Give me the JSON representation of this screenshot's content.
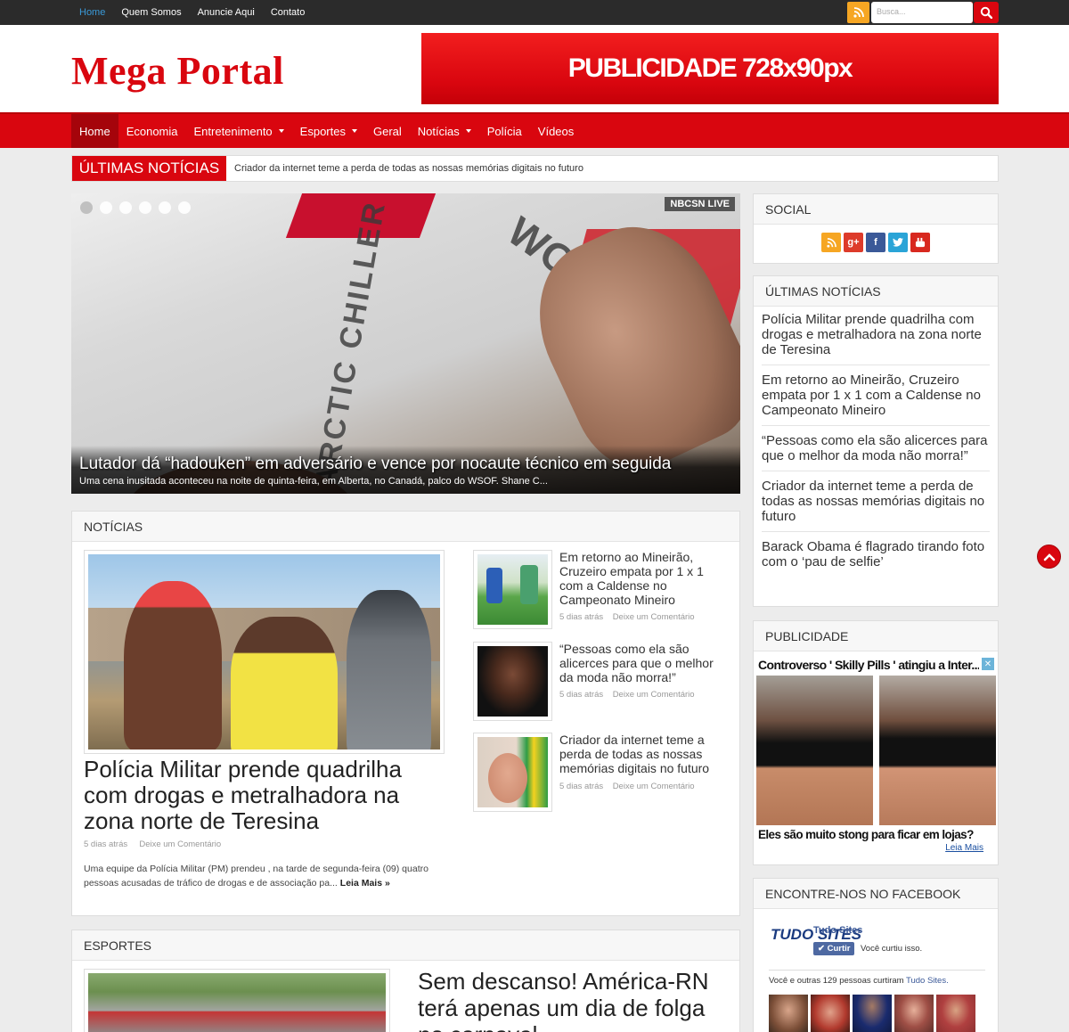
{
  "topbar": {
    "links": [
      "Home",
      "Quem Somos",
      "Anuncie Aqui",
      "Contato"
    ],
    "search_placeholder": "Busca..."
  },
  "header": {
    "logo": "Mega Portal",
    "ad_text": "PUBLICIDADE 728x90px"
  },
  "nav": {
    "items": [
      {
        "label": "Home",
        "active": true
      },
      {
        "label": "Economia"
      },
      {
        "label": "Entretenimento",
        "dropdown": true
      },
      {
        "label": "Esportes",
        "dropdown": true
      },
      {
        "label": "Geral"
      },
      {
        "label": "Notícias",
        "dropdown": true
      },
      {
        "label": "Polícia"
      },
      {
        "label": "Vídeos"
      }
    ]
  },
  "ticker": {
    "label": "ÚLTIMAS NOTÍCIAS",
    "text": "Criador da internet teme a perda de todas as nossas memórias digitais no futuro"
  },
  "slider": {
    "title": "Lutador dá “hadouken” em adversário e vence por nocaute técnico em seguida",
    "subtitle": "Uma cena inusitada aconteceu na noite de quinta-feira, em Alberta, no Canadá, palco do WSOF. Shane C...",
    "nbc_badge": "NBCSN LIVE",
    "ring_text_left": "ARCTIC CHILLER",
    "ring_text_right": "WORLD"
  },
  "noticias": {
    "heading": "NOTÍCIAS",
    "featured": {
      "title": "Polícia Militar prende quadrilha com drogas e metralhadora na zona norte de Teresina",
      "time": "5 dias atrás",
      "comment": "Deixe um Comentário",
      "excerpt": "Uma equipe da Polícia Militar (PM) prendeu , na tarde de segunda-feira (09)  quatro pessoas acusadas de tráfico de drogas e de associação pa...",
      "read_more": "Leia Mais »"
    },
    "side": [
      {
        "title": "Em retorno ao Mineirão, Cruzeiro empata por 1 x 1 com a Caldense no Campeonato Mineiro",
        "time": "5 dias atrás",
        "comment": "Deixe um Comentário"
      },
      {
        "title": "“Pessoas como ela são alicerces para que o melhor da moda não morra!”",
        "time": "5 dias atrás",
        "comment": "Deixe um Comentário"
      },
      {
        "title": "Criador da internet teme a perda de todas as nossas memórias digitais no futuro",
        "time": "5 dias atrás",
        "comment": "Deixe um Comentário"
      }
    ]
  },
  "esportes": {
    "heading": "ESPORTES",
    "title": "Sem descanso! América-RN terá apenas um dia de folga no carnaval"
  },
  "sidebar": {
    "social_heading": "SOCIAL",
    "latest_heading": "ÚLTIMAS NOTÍCIAS",
    "latest": [
      "Polícia Militar prende quadrilha com drogas e metralhadora na zona norte de Teresina",
      "Em retorno ao Mineirão, Cruzeiro empata por 1 x 1 com a Caldense no Campeonato Mineiro",
      "“Pessoas como ela são alicerces para que o melhor da moda não morra!”",
      "Criador da internet teme a perda de todas as nossas memórias digitais no futuro",
      "Barack Obama é flagrado tirando foto com o ‘pau de selfie’"
    ],
    "ad_heading": "PUBLICIDADE",
    "ad_title": "Controverso ' Skilly Pills ' atingiu a Inter...",
    "ad_footer": "Eles são muito stong para ficar em lojas?",
    "ad_more": "Leia Mais",
    "fb_heading": "ENCONTRE-NOS NO FACEBOOK",
    "fb_logo": "TUDO SITES",
    "fb_page": "Tudo Sites",
    "fb_like": "✔ Curtir",
    "fb_liked": "Você curtiu isso.",
    "fb_count_prefix": "Você e outras 129 pessoas curtiram",
    "fb_count_page": "Tudo Sites."
  },
  "icons": {
    "social": [
      "rss-icon",
      "google-plus-icon",
      "facebook-icon",
      "twitter-icon",
      "youtube-icon"
    ]
  },
  "colors": {
    "brand": "#d9060f",
    "topbar": "#2b2b2b",
    "link_active": "#3a9ad9"
  }
}
